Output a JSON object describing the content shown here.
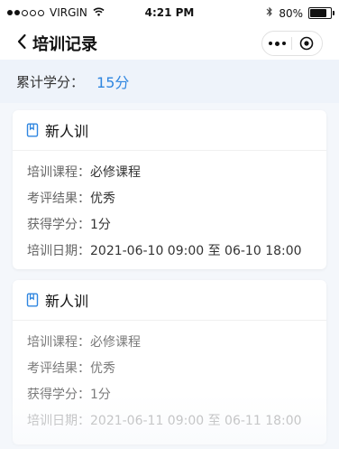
{
  "status_bar": {
    "carrier": "VIRGIN",
    "time": "4:21 PM",
    "battery": "80%"
  },
  "nav": {
    "title": "培训记录"
  },
  "summary": {
    "label": "累计学分：",
    "value": "15分"
  },
  "records": [
    {
      "title": "新人训",
      "fields": [
        {
          "label": "培训课程：",
          "value": "必修课程"
        },
        {
          "label": "考评结果：",
          "value": "优秀"
        },
        {
          "label": "获得学分：",
          "value": "1分"
        },
        {
          "label": "培训日期：",
          "value": "2021-06-10 09:00 至 06-10 18:00"
        }
      ]
    },
    {
      "title": "新人训",
      "fields": [
        {
          "label": "培训课程：",
          "value": "必修课程"
        },
        {
          "label": "考评结果：",
          "value": "优秀"
        },
        {
          "label": "获得学分：",
          "value": "1分"
        },
        {
          "label": "培训日期：",
          "value": "2021-06-11 09:00 至 06-11 18:00"
        }
      ]
    }
  ],
  "icons": {
    "signal": "signal-dots-icon",
    "wifi": "wifi-icon",
    "bluetooth": "bluetooth-icon",
    "battery": "battery-icon",
    "back": "chevron-left-icon",
    "more": "more-dots-icon",
    "close": "target-circle-icon",
    "record": "book-icon"
  },
  "colors": {
    "accent": "#2f86e0",
    "summary_bg": "#eef3fa",
    "page_bg": "#f4f7fb"
  }
}
